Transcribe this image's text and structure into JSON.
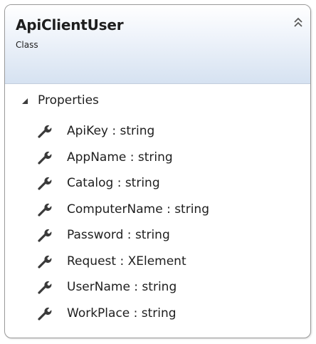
{
  "class": {
    "name": "ApiClientUser",
    "stereotype": "Class",
    "collapse_icon": "double-chevron-up-icon"
  },
  "compartment": {
    "label": "Properties",
    "toggle_icon": "expanded-triangle-icon",
    "member_icon": "wrench-icon",
    "members": [
      {
        "text": "ApiKey : string"
      },
      {
        "text": "AppName : string"
      },
      {
        "text": "Catalog : string"
      },
      {
        "text": "ComputerName : string"
      },
      {
        "text": "Password : string"
      },
      {
        "text": "Request : XElement"
      },
      {
        "text": "UserName : string"
      },
      {
        "text": "WorkPlace : string"
      }
    ]
  },
  "colors": {
    "border": "#9a9a9a",
    "header_gradient_top": "#ffffff",
    "header_gradient_bottom": "#d6e2f1",
    "text": "#1e1e1e"
  }
}
